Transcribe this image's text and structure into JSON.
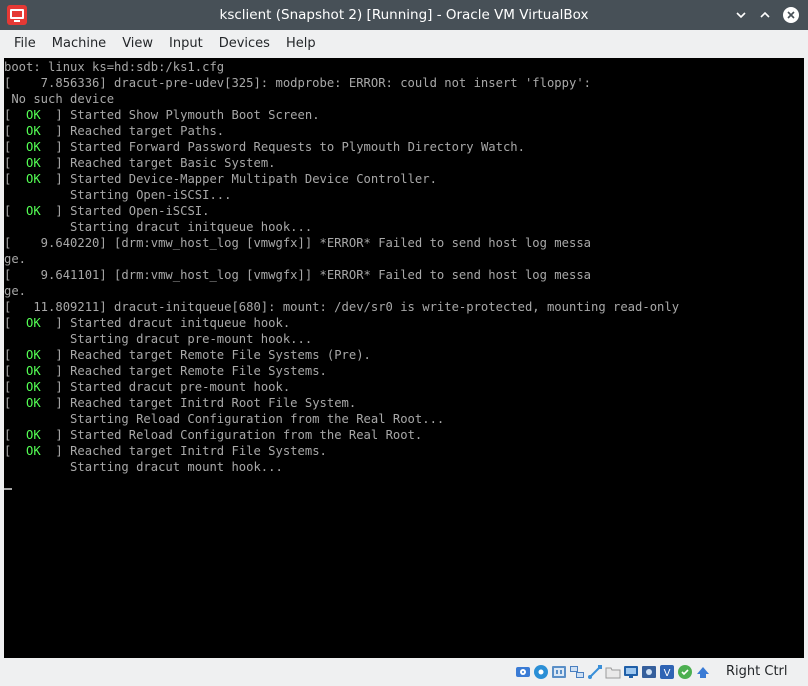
{
  "window": {
    "title": "ksclient (Snapshot 2) [Running] - Oracle VM VirtualBox"
  },
  "menu": [
    {
      "label": "File",
      "name": "menu-file"
    },
    {
      "label": "Machine",
      "name": "menu-machine"
    },
    {
      "label": "View",
      "name": "menu-view"
    },
    {
      "label": "Input",
      "name": "menu-input"
    },
    {
      "label": "Devices",
      "name": "menu-devices"
    },
    {
      "label": "Help",
      "name": "menu-help"
    }
  ],
  "console_lines": [
    {
      "text": "boot: linux ks=hd:sdb:/ks1.cfg"
    },
    {
      "text": "[    7.856336] dracut-pre-udev[325]: modprobe: ERROR: could not insert 'floppy':"
    },
    {
      "text": " No such device"
    },
    {
      "ok": "OK",
      "text": "Started Show Plymouth Boot Screen."
    },
    {
      "ok": "OK",
      "text": "Reached target Paths."
    },
    {
      "ok": "OK",
      "text": "Started Forward Password Requests to Plymouth Directory Watch."
    },
    {
      "ok": "OK",
      "text": "Reached target Basic System."
    },
    {
      "ok": "OK",
      "text": "Started Device-Mapper Multipath Device Controller."
    },
    {
      "text": "         Starting Open-iSCSI..."
    },
    {
      "ok": "OK",
      "text": "Started Open-iSCSI."
    },
    {
      "text": "         Starting dracut initqueue hook..."
    },
    {
      "text": "[    9.640220] [drm:vmw_host_log [vmwgfx]] *ERROR* Failed to send host log messa"
    },
    {
      "text": "ge."
    },
    {
      "text": "[    9.641101] [drm:vmw_host_log [vmwgfx]] *ERROR* Failed to send host log messa"
    },
    {
      "text": "ge."
    },
    {
      "text": "[   11.809211] dracut-initqueue[680]: mount: /dev/sr0 is write-protected, mounting read-only"
    },
    {
      "ok": "OK",
      "text": "Started dracut initqueue hook."
    },
    {
      "text": "         Starting dracut pre-mount hook..."
    },
    {
      "ok": "OK",
      "text": "Reached target Remote File Systems (Pre)."
    },
    {
      "ok": "OK",
      "text": "Reached target Remote File Systems."
    },
    {
      "ok": "OK",
      "text": "Started dracut pre-mount hook."
    },
    {
      "ok": "OK",
      "text": "Reached target Initrd Root File System."
    },
    {
      "text": "         Starting Reload Configuration from the Real Root..."
    },
    {
      "ok": "OK",
      "text": "Started Reload Configuration from the Real Root."
    },
    {
      "ok": "OK",
      "text": "Reached target Initrd File Systems."
    },
    {
      "text": "         Starting dracut mount hook..."
    }
  ],
  "statusbar": {
    "icons": [
      "hard-disk-icon",
      "optical-drive-icon",
      "audio-icon",
      "network-icon",
      "usb-icon",
      "shared-folders-icon",
      "display-icon",
      "video-capture-icon",
      "cpu-virtualization-icon",
      "mouse-integration-icon",
      "keyboard-icon"
    ],
    "host_key": "Right Ctrl"
  },
  "colors": {
    "titlebar": "#475057",
    "console_text": "#a8a8a8",
    "ok_green": "#54ff54",
    "screen_bg": "#000000"
  }
}
